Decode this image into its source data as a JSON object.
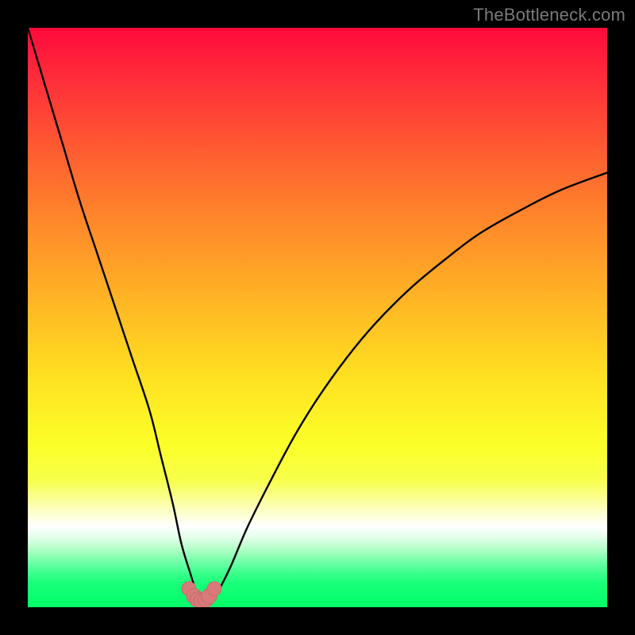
{
  "watermark": "TheBottleneck.com",
  "colors": {
    "frame": "#000000",
    "curve": "#000000",
    "marker_fill": "#d97a7a",
    "marker_stroke": "#c96a6a",
    "gradient_top": "#ff0a3c",
    "gradient_bottom": "#00ff66"
  },
  "chart_data": {
    "type": "line",
    "title": "",
    "xlabel": "",
    "ylabel": "",
    "xlim": [
      0,
      100
    ],
    "ylim": [
      0,
      100
    ],
    "grid": false,
    "annotations": [],
    "series": [
      {
        "name": "bottleneck-curve",
        "x": [
          0,
          3,
          6,
          9,
          12,
          15,
          18,
          21,
          23,
          25,
          26.5,
          28,
          29,
          30,
          31,
          32,
          33,
          35,
          38,
          42,
          46,
          50,
          55,
          60,
          66,
          72,
          78,
          85,
          92,
          100
        ],
        "y": [
          100,
          90,
          80,
          70,
          61,
          52,
          43,
          34,
          26,
          18,
          11,
          6,
          3,
          1.3,
          1.1,
          1.3,
          3,
          7,
          14,
          22,
          29.5,
          36,
          43,
          49,
          55,
          60,
          64.5,
          68.5,
          72,
          75
        ]
      }
    ],
    "markers": {
      "name": "bottom-marker",
      "x": [
        27.8,
        28.7,
        29.3,
        30,
        30.7,
        31.3,
        32.2
      ],
      "y": [
        3.2,
        1.9,
        1.3,
        1.1,
        1.3,
        1.9,
        3.2
      ],
      "r": [
        1.2,
        1.4,
        1.4,
        1.4,
        1.4,
        1.4,
        1.2
      ]
    }
  }
}
